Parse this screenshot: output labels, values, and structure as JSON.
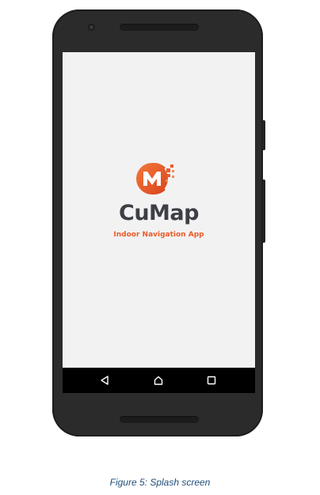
{
  "splash": {
    "app_name": "CuMap",
    "tagline": "Indoor Navigation App",
    "logo_icon": "cumap-m-logo-icon",
    "brand_color": "#ea5b2a",
    "text_color": "#3d3f46",
    "background_color": "#f2f2f2"
  },
  "navbar": {
    "items": [
      {
        "name": "back",
        "icon": "triangle-back-icon"
      },
      {
        "name": "home",
        "icon": "circle-home-icon"
      },
      {
        "name": "recents",
        "icon": "square-recents-icon"
      }
    ]
  },
  "caption": "Figure 5: Splash screen"
}
